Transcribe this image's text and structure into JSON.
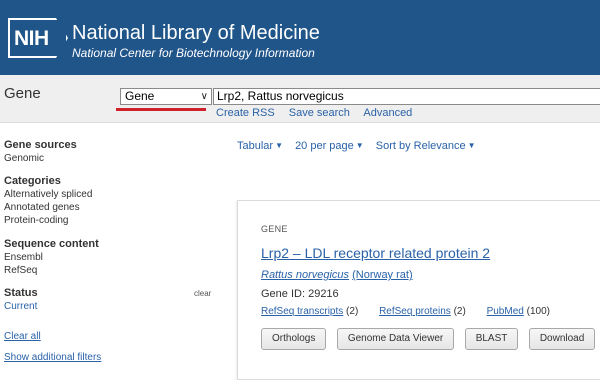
{
  "header": {
    "logo_text": "NIH",
    "title": "National Library of Medicine",
    "subtitle": "National Center for Biotechnology Information",
    "background_color": "#20558a"
  },
  "search": {
    "db_label": "Gene",
    "db_selected": "Gene",
    "query": "Lrp2, Rattus norvegicus",
    "links": [
      "Create RSS",
      "Save search",
      "Advanced"
    ],
    "underline_color": "#d0202a"
  },
  "sidebar": {
    "gene_sources": {
      "title": "Gene sources",
      "items": [
        "Genomic"
      ]
    },
    "categories": {
      "title": "Categories",
      "items": [
        "Alternatively spliced",
        "Annotated genes",
        "Protein-coding"
      ]
    },
    "sequence_content": {
      "title": "Sequence content",
      "items": [
        "Ensembl",
        "RefSeq"
      ]
    },
    "status": {
      "title": "Status",
      "clear": "clear",
      "items": [
        "Current"
      ]
    },
    "clear_all": "Clear all",
    "show_filters": "Show additional filters"
  },
  "toolbar": {
    "format": "Tabular",
    "per_page": "20 per page",
    "sort": "Sort by Relevance"
  },
  "result": {
    "tag": "GENE",
    "title": "Lrp2  –  LDL receptor related protein 2",
    "organism_latin": "Rattus norvegicus",
    "organism_common": "(Norway rat)",
    "gene_id": "Gene ID: 29216",
    "links": [
      {
        "label": "RefSeq transcripts",
        "count": "(2)"
      },
      {
        "label": "RefSeq proteins",
        "count": "(2)"
      },
      {
        "label": "PubMed",
        "count": "(100)"
      }
    ],
    "buttons": [
      "Orthologs",
      "Genome Data Viewer",
      "BLAST",
      "Download"
    ]
  },
  "colors": {
    "link": "#2a62a8"
  }
}
